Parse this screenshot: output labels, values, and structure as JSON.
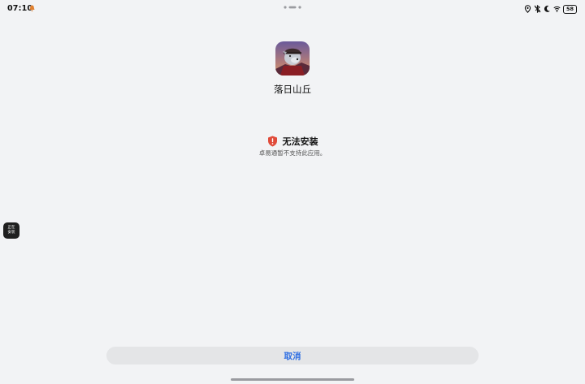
{
  "status_bar": {
    "time": "07:10",
    "battery": "58",
    "icons": [
      "location-icon",
      "bluetooth-off-icon",
      "do-not-disturb-moon-icon",
      "wifi-icon"
    ]
  },
  "app": {
    "name": "落日山丘",
    "icon": "app-icon"
  },
  "error": {
    "title": "无法安装",
    "description": "卓易通暂不支持此应用。",
    "icon": "shield-warning-icon",
    "color": "#e04b3a"
  },
  "floating_button": {
    "line1": "正在",
    "line2": "安装"
  },
  "actions": {
    "cancel_label": "取消",
    "accent_color": "#2f6fe3"
  }
}
